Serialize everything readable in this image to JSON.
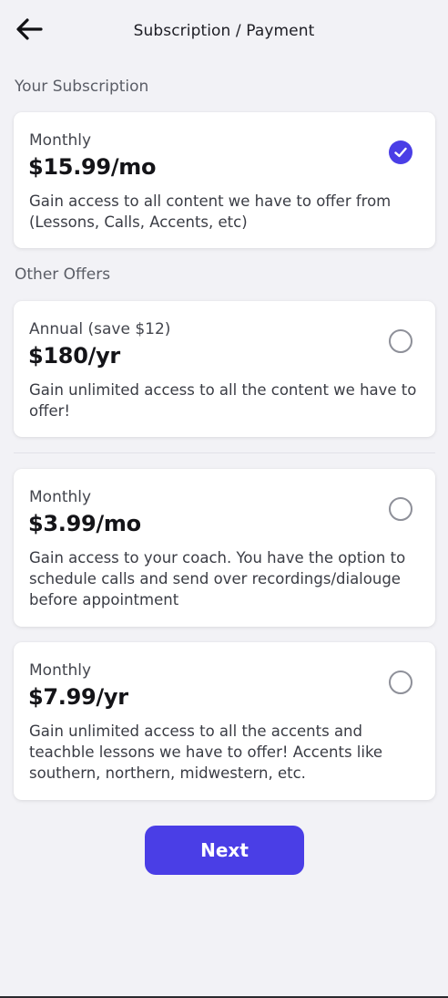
{
  "header": {
    "title": "Subscription / Payment",
    "back_icon": "arrow-left-icon"
  },
  "current_section": {
    "label": "Your Subscription"
  },
  "current_plan": {
    "period": "Monthly",
    "price": "$15.99/mo",
    "description": "Gain access to all content we have to offer from (Lessons, Calls, Accents, etc)",
    "selected": true
  },
  "offers_section": {
    "label": "Other Offers"
  },
  "offers": [
    {
      "period": "Annual (save $12)",
      "price": "$180/yr",
      "description": "Gain unlimited access to all the content we have to offer!",
      "selected": false
    },
    {
      "period": "Monthly",
      "price": "$3.99/mo",
      "description": "Gain access to your coach. You have the option to schedule calls and send over recordings/dialouge before appointment",
      "selected": false
    },
    {
      "period": "Monthly",
      "price": "$7.99/yr",
      "description": "Gain unlimited access to all the accents and teachble lessons we have to offer! Accents like southern, northern, midwestern, etc.",
      "selected": false
    }
  ],
  "footer": {
    "next_label": "Next"
  },
  "colors": {
    "accent": "#4a3ee6",
    "background": "#f2f2f6",
    "card": "#ffffff"
  }
}
